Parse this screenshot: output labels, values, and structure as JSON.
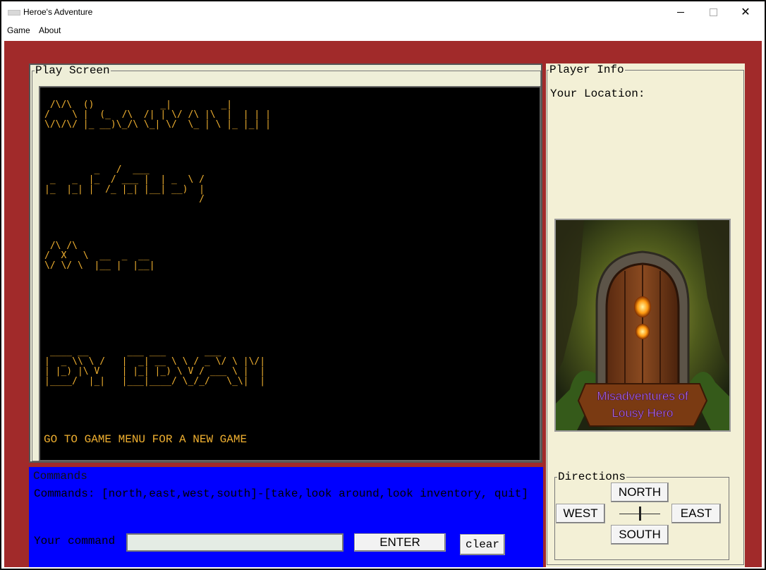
{
  "window": {
    "title": "Heroe's Adventure"
  },
  "menubar": {
    "items": [
      "Game",
      "About"
    ]
  },
  "play_screen": {
    "title": "Play Screen",
    "ascii_lines": [
      " /\\/\\  ()            _|         _|     ",
      "/    \\ |  (_  /\\  /| | \\/ /\\ |\\  |  | | |",
      "\\/\\/\\/ |_ __)\\_/\\ \\_| \\/  \\_ | \\ |_ |_| |",
      "",
      "         _   /  ___",
      " _   _  |_  / ___ |  | _  \\ /",
      "|_  |_| |  /_ |_| |__| __)  |",
      "                            /",
      "",
      " /\\ /\\",
      "/  X   \\  __  _  __",
      "\\/ \\/ \\  |__ |  |__|",
      "",
      " ____ __       ___ ___       ___",
      "|  _ \\\\ \\ /   |  _| __ \\ \\ / _ \\/ \\ |\\/|",
      "| |_) |\\ V    | |_| |_) \\ V / ___ \\ |  |",
      "|____/  |_|   |___|____/ \\_/_/   \\_\\|  |"
    ],
    "hint": "GO TO GAME MENU FOR A NEW GAME"
  },
  "player_info": {
    "title": "Player Info",
    "location_label": "Your Location:",
    "image_caption_line1": "Misadventures of",
    "image_caption_line2": "Lousy Hero"
  },
  "directions": {
    "title": "Directions",
    "north": "NORTH",
    "south": "SOUTH",
    "west": "WEST",
    "east": "EAST"
  },
  "commands": {
    "title": "Commands",
    "text": "Commands: [north,east,west,south]-[take,look around,look inventory, quit]",
    "input_label": "Your command",
    "input_value": "",
    "enter_label": "ENTER",
    "clear_label": "clear"
  },
  "colors": {
    "frame": "#a12a2a",
    "ascii": "#f0b030",
    "commands_bg": "#0000ff",
    "panel_bg": "#eeeed8"
  }
}
